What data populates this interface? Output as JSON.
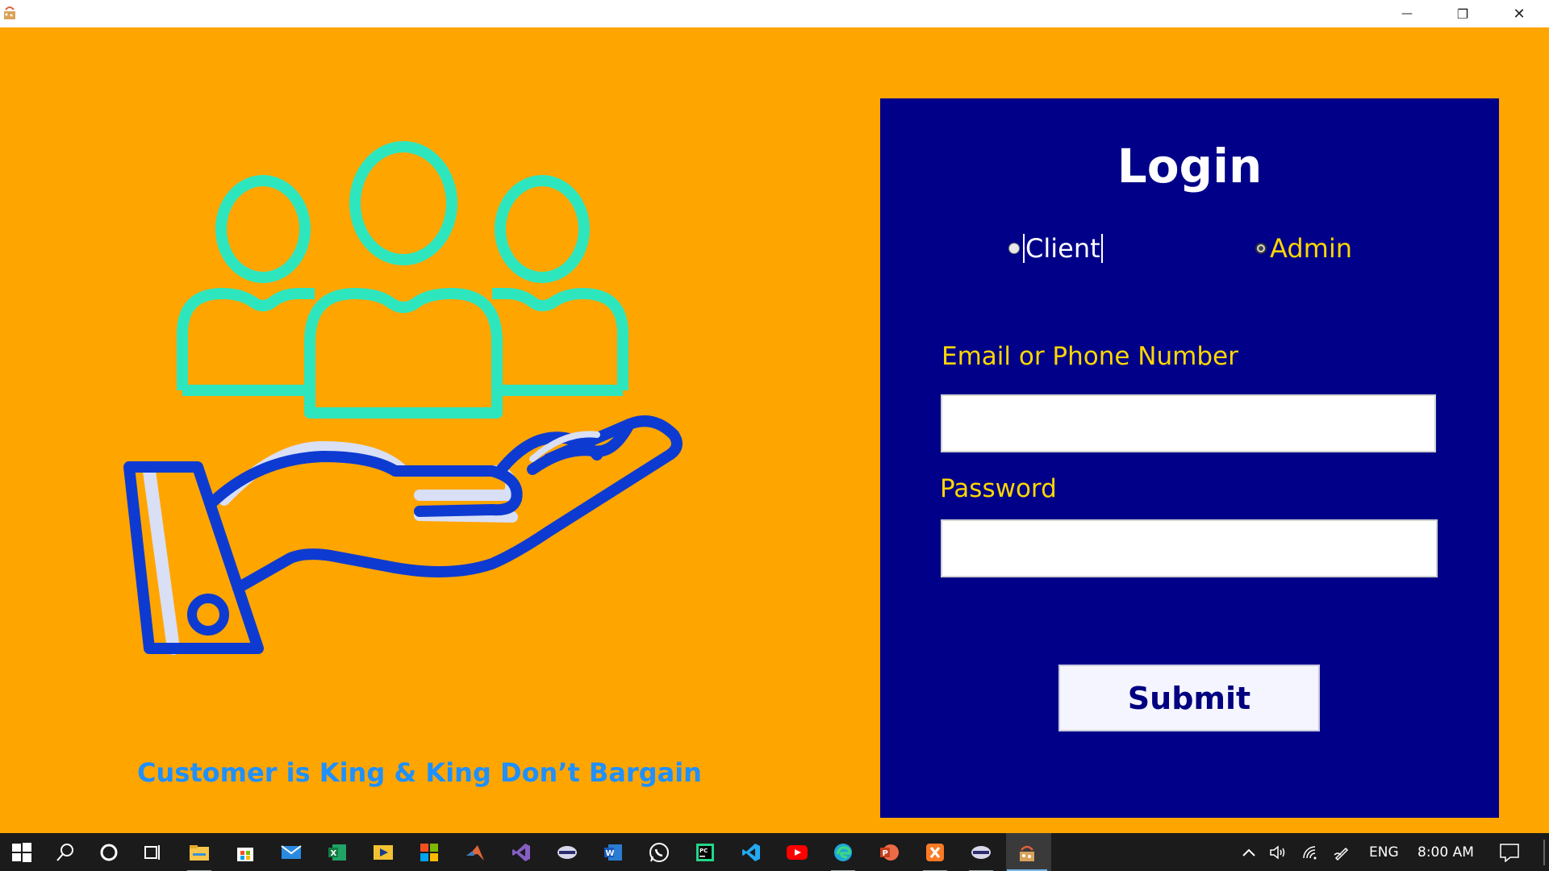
{
  "window": {
    "minimize_glyph": "—",
    "maximize_glyph": "❐",
    "close_glyph": "✕"
  },
  "illustration": {
    "icon": "customers-in-hand-illustration",
    "people_color": "#2EE6BE",
    "hand_color": "#0D3BD1"
  },
  "tagline": "Customer is King & King Don’t Bargain",
  "login": {
    "title": "Login",
    "roles": [
      {
        "label": "Client",
        "checked": false
      },
      {
        "label": "Admin",
        "checked": true
      }
    ],
    "email_label": "Email or Phone Number",
    "email_value": "",
    "password_label": "Password",
    "password_value": "",
    "submit_label": "Submit"
  },
  "colors": {
    "background": "#FFA500",
    "panel": "#000088",
    "label": "#FFD700",
    "tagline": "#1E90FF"
  },
  "taskbar": {
    "apps": [
      "start-icon",
      "search-icon",
      "cortana-icon",
      "task-view-icon",
      "file-explorer-icon",
      "store-icon",
      "mail-icon",
      "excel-icon",
      "media-icon",
      "office-icon",
      "matlab-icon",
      "visual-studio-icon",
      "netbeans-icon",
      "word-icon",
      "whatsapp-icon",
      "pycharm-icon",
      "vscode-icon",
      "youtube-icon",
      "edge-icon",
      "powerpoint-icon",
      "xampp-icon",
      "netbeans2-icon",
      "java-app-icon"
    ],
    "language": "ENG",
    "time": "8:00 AM"
  }
}
